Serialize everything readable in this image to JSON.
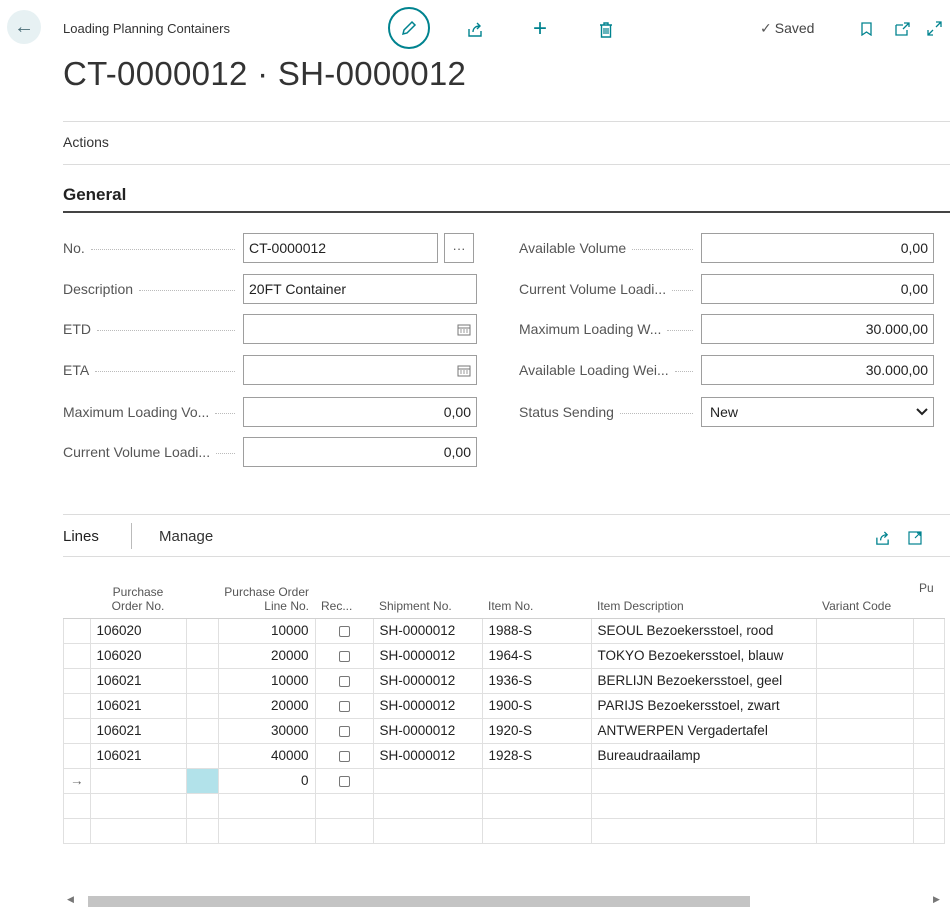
{
  "header": {
    "caption": "Loading Planning Containers",
    "title": "CT-0000012 · SH-0000012",
    "saved_label": "Saved",
    "icons": [
      "back-arrow-icon",
      "pencil-icon",
      "share-icon",
      "plus-icon",
      "trash-icon",
      "bookmark-icon",
      "open-new-icon",
      "expand-icon"
    ]
  },
  "actions_label": "Actions",
  "general": {
    "heading": "General",
    "left": [
      {
        "label": "No.",
        "value": "CT-0000012"
      },
      {
        "label": "Description",
        "value": "20FT Container"
      },
      {
        "label": "ETD",
        "value": ""
      },
      {
        "label": "ETA",
        "value": ""
      },
      {
        "label": "Maximum Loading Vo...",
        "value": "0,00"
      },
      {
        "label": "Current Volume Loadi...",
        "value": "0,00"
      }
    ],
    "right": [
      {
        "label": "Available Volume",
        "value": "0,00"
      },
      {
        "label": "Current Volume Loadi...",
        "value": "0,00"
      },
      {
        "label": "Maximum Loading W...",
        "value": "30.000,00"
      },
      {
        "label": "Available Loading Wei...",
        "value": "30.000,00"
      },
      {
        "label": "Status Sending",
        "value": "New"
      }
    ],
    "assist_label": "···"
  },
  "lines": {
    "tab_label": "Lines",
    "manage_label": "Manage",
    "columns": {
      "po_no": "Purchase Order No.",
      "po_line_no": "Purchase Order Line No.",
      "rec": "Rec...",
      "shipment_no": "Shipment No.",
      "item_no": "Item No.",
      "item_desc": "Item Description",
      "variant": "Variant Code",
      "pu": "Pu"
    },
    "rows": [
      {
        "po": "106020",
        "line": "10000",
        "ship": "SH-0000012",
        "item": "1988-S",
        "desc": "SEOUL Bezoekersstoel, rood"
      },
      {
        "po": "106020",
        "line": "20000",
        "ship": "SH-0000012",
        "item": "1964-S",
        "desc": "TOKYO Bezoekersstoel, blauw"
      },
      {
        "po": "106021",
        "line": "10000",
        "ship": "SH-0000012",
        "item": "1936-S",
        "desc": "BERLIJN Bezoekersstoel, geel"
      },
      {
        "po": "106021",
        "line": "20000",
        "ship": "SH-0000012",
        "item": "1900-S",
        "desc": "PARIJS Bezoekersstoel, zwart"
      },
      {
        "po": "106021",
        "line": "30000",
        "ship": "SH-0000012",
        "item": "1920-S",
        "desc": "ANTWERPEN Vergadertafel"
      },
      {
        "po": "106021",
        "line": "40000",
        "ship": "SH-0000012",
        "item": "1928-S",
        "desc": "Bureaudraailamp"
      },
      {
        "po": "",
        "line": "0",
        "ship": "",
        "item": "",
        "desc": ""
      }
    ]
  }
}
